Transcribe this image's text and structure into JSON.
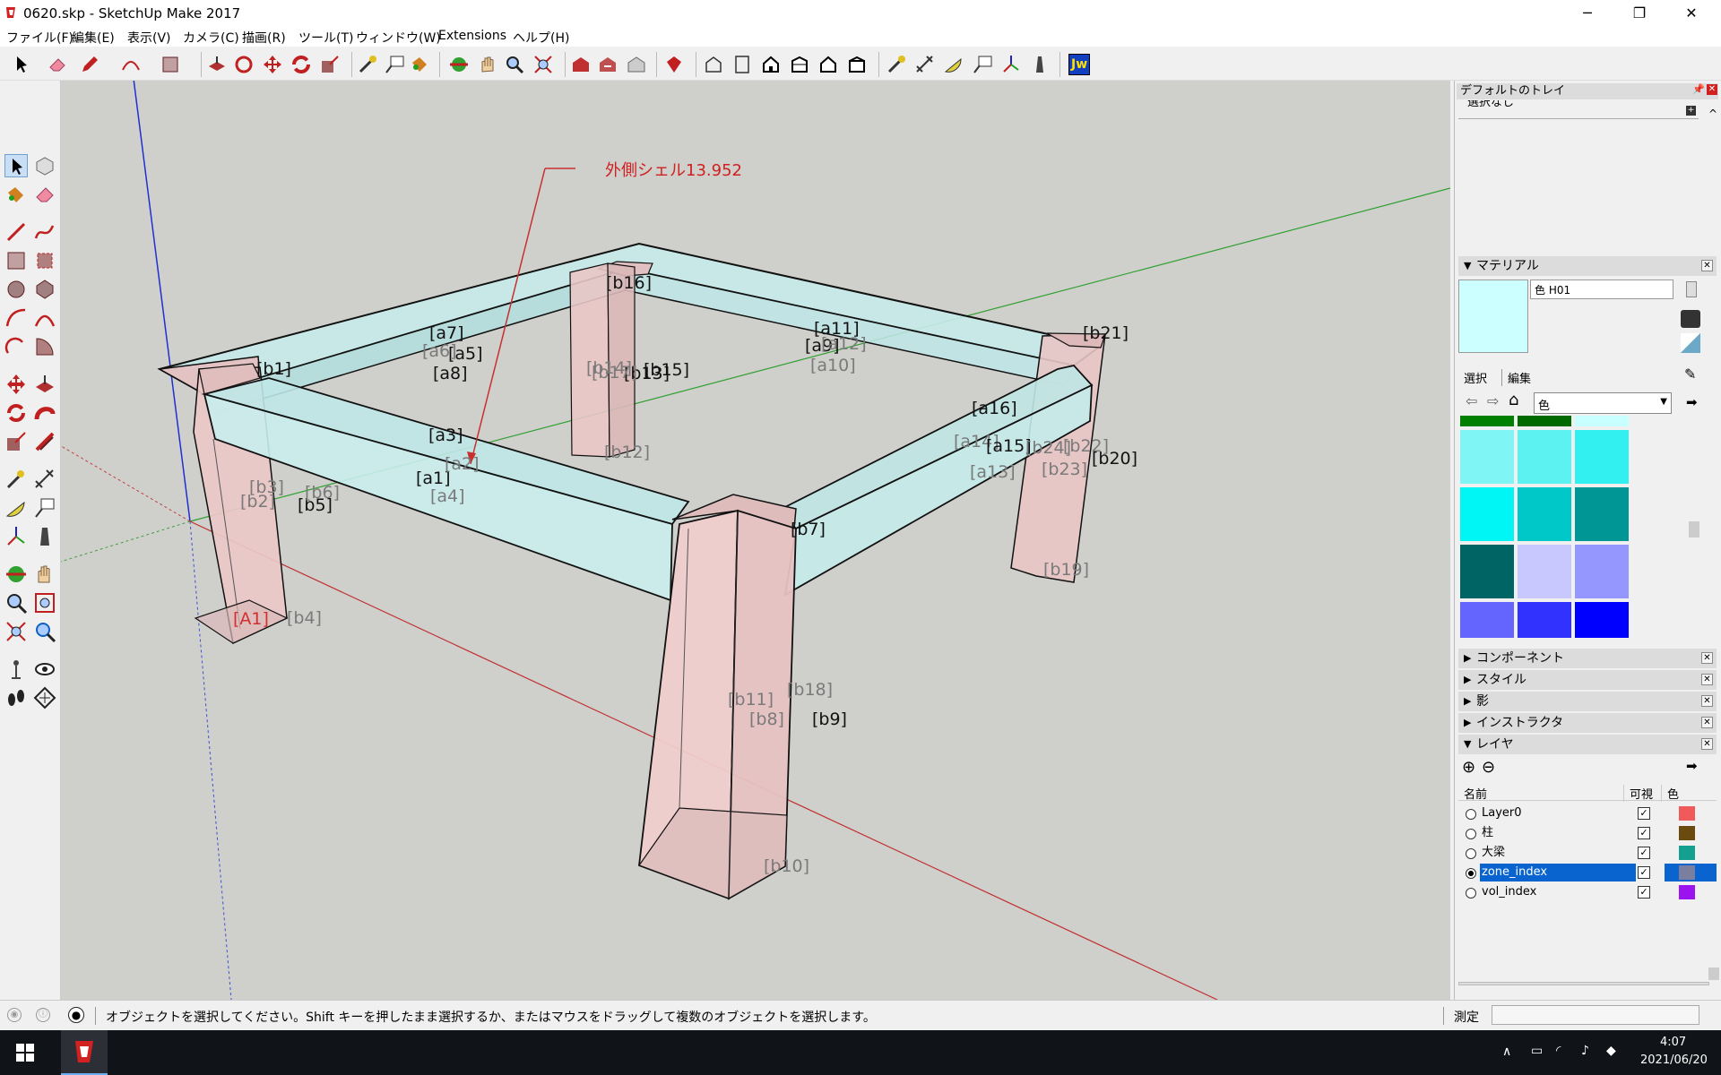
{
  "window": {
    "title": "0620.skp - SketchUp Make 2017",
    "minimize": "─",
    "maximize": "❐",
    "close": "✕"
  },
  "menu": [
    "ファイル(F)",
    "編集(E)",
    "表示(V)",
    "カメラ(C)",
    "描画(R)",
    "ツール(T)",
    "ウィンドウ(W)",
    "Extensions",
    "ヘルプ(H)"
  ],
  "toolbar": {
    "jw_label": "Jw"
  },
  "model": {
    "annotation": "外側シェル13.952",
    "labels": [
      {
        "text": "[a1]",
        "style": "dark"
      },
      {
        "text": "[a2]",
        "style": "light"
      },
      {
        "text": "[a3]",
        "style": "dark"
      },
      {
        "text": "[a4]",
        "style": "light"
      },
      {
        "text": "[a5]",
        "style": "dark"
      },
      {
        "text": "[a6]",
        "style": "light"
      },
      {
        "text": "[a7]",
        "style": "dark"
      },
      {
        "text": "[a8]",
        "style": "dark"
      },
      {
        "text": "[a9]",
        "style": "dark"
      },
      {
        "text": "[a10]",
        "style": "light"
      },
      {
        "text": "[a11]",
        "style": "dark"
      },
      {
        "text": "[a12]",
        "style": "light"
      },
      {
        "text": "[a13]",
        "style": "light"
      },
      {
        "text": "[a14]",
        "style": "light"
      },
      {
        "text": "[a15]",
        "style": "dark"
      },
      {
        "text": "[a16]",
        "style": "dark"
      },
      {
        "text": "[b1]",
        "style": "dark"
      },
      {
        "text": "[b2]",
        "style": "light"
      },
      {
        "text": "[b3]",
        "style": "light"
      },
      {
        "text": "[b4]",
        "style": "light"
      },
      {
        "text": "[b5]",
        "style": "dark"
      },
      {
        "text": "[b6]",
        "style": "light"
      },
      {
        "text": "[b7]",
        "style": "dark"
      },
      {
        "text": "[b8]",
        "style": "light"
      },
      {
        "text": "[b9]",
        "style": "dark"
      },
      {
        "text": "[b10]",
        "style": "light"
      },
      {
        "text": "[b11]",
        "style": "light"
      },
      {
        "text": "[b12]",
        "style": "light"
      },
      {
        "text": "[b13]",
        "style": "dark"
      },
      {
        "text": "[b14]",
        "style": "light"
      },
      {
        "text": "[b15]",
        "style": "dark"
      },
      {
        "text": "[b16]",
        "style": "dark"
      },
      {
        "text": "[b17]",
        "style": "light"
      },
      {
        "text": "[b18]",
        "style": "light"
      },
      {
        "text": "[b19]",
        "style": "light"
      },
      {
        "text": "[b20]",
        "style": "dark"
      },
      {
        "text": "[b21]",
        "style": "dark"
      },
      {
        "text": "[b22]",
        "style": "light"
      },
      {
        "text": "[b23]",
        "style": "light"
      },
      {
        "text": "[b24]",
        "style": "light"
      },
      {
        "text": "[A1]",
        "style": "red"
      }
    ]
  },
  "tray": {
    "title": "デフォルトのトレイ",
    "entity_info": "選択なし",
    "materials": {
      "header": "マテリアル",
      "name": "色 H01",
      "tab_select": "選択",
      "tab_edit": "編集",
      "library": "色",
      "swatches": [
        "#007f00",
        "#006a00",
        "#c8ffff",
        "#7ff5f5",
        "#5cf2f2",
        "#33f0f0",
        "#00f5f5",
        "#00c8c8",
        "#009696",
        "#006464",
        "#c8c8ff",
        "#9696ff",
        "#6464ff",
        "#3232ff",
        "#0000ff"
      ]
    },
    "panels": [
      "コンポーネント",
      "スタイル",
      "影",
      "インストラクタ"
    ],
    "layers": {
      "header": "レイヤ",
      "col_name": "名前",
      "col_visible": "可視",
      "col_color": "色",
      "rows": [
        {
          "name": "Layer0",
          "color": "#f05a5a",
          "active": false
        },
        {
          "name": "柱",
          "color": "#6b4a10",
          "active": false
        },
        {
          "name": "大梁",
          "color": "#14a090",
          "active": false
        },
        {
          "name": "zone_index",
          "color": "#7a7fa0",
          "active": true
        },
        {
          "name": "vol_index",
          "color": "#9b14f0",
          "active": false
        }
      ]
    }
  },
  "status": {
    "message": "オブジェクトを選択してください。Shift キーを押したまま選択するか、またはマウスをドラッグして複数のオブジェクトを選択します。",
    "measure_label": "測定"
  },
  "taskbar": {
    "time": "4:07",
    "date": "2021/06/20"
  }
}
